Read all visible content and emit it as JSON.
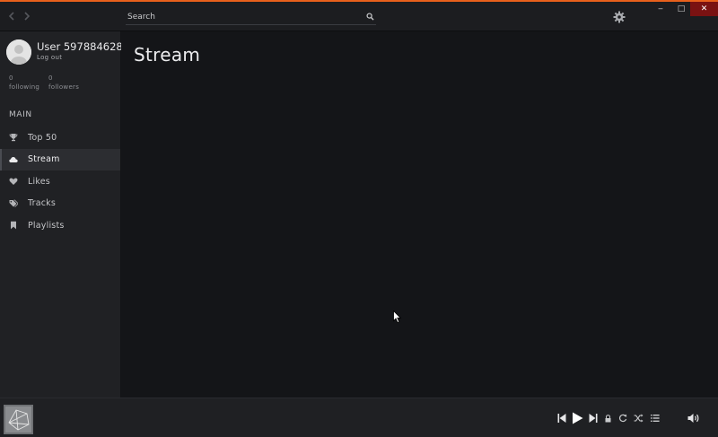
{
  "window": {
    "minimize_label": "‒",
    "maximize_label": "□",
    "close_label": "✕",
    "accent_color": "#e8601c",
    "close_color": "#7a1212"
  },
  "titlebar": {
    "back_icon": "chevron-left-icon",
    "forward_icon": "chevron-right-icon",
    "search": {
      "placeholder": "Search",
      "value": ""
    },
    "settings_icon": "gear-icon"
  },
  "user": {
    "name": "User 597884628",
    "logout_label": "Log out",
    "following_count": "0",
    "following_label": "following",
    "followers_count": "0",
    "followers_label": "followers"
  },
  "sidebar": {
    "section_title": "MAIN",
    "items": [
      {
        "label": "Top 50",
        "icon": "trophy-icon",
        "active": false
      },
      {
        "label": "Stream",
        "icon": "cloud-icon",
        "active": true
      },
      {
        "label": "Likes",
        "icon": "heart-icon",
        "active": false
      },
      {
        "label": "Tracks",
        "icon": "tags-icon",
        "active": false
      },
      {
        "label": "Playlists",
        "icon": "bookmark-icon",
        "active": false
      }
    ]
  },
  "main": {
    "title": "Stream"
  },
  "player": {
    "controls": [
      "previous-icon",
      "play-icon",
      "next-icon",
      "lock-icon",
      "repeat-icon",
      "shuffle-icon",
      "queue-icon",
      "volume-icon"
    ]
  }
}
